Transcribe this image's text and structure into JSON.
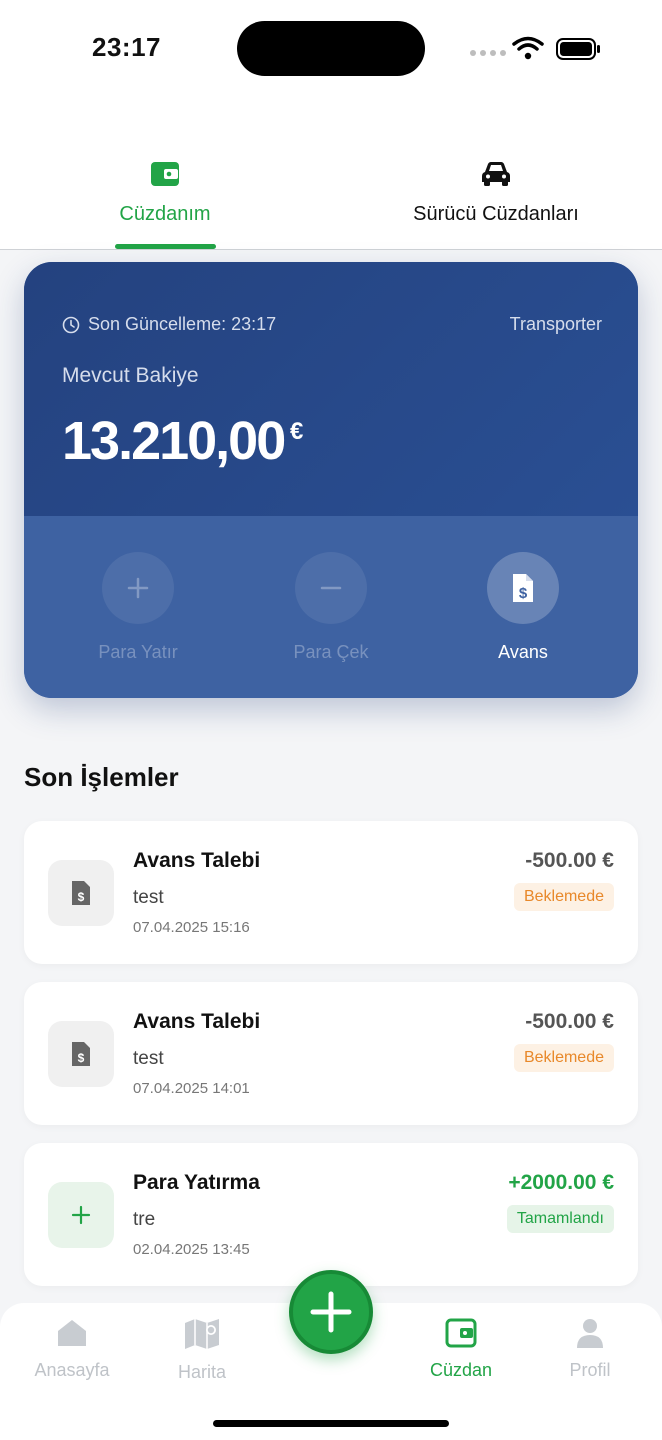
{
  "status_bar": {
    "time": "23:17"
  },
  "tabs": [
    {
      "label": "Cüzdanım",
      "icon": "wallet-icon",
      "active": true
    },
    {
      "label": "Sürücü Cüzdanları",
      "icon": "car-icon",
      "active": false
    }
  ],
  "wallet_card": {
    "updated_label": "Son Güncelleme: 23:17",
    "role": "Transporter",
    "balance_label": "Mevcut Bakiye",
    "balance_amount": "13.210,00",
    "balance_currency": "€",
    "actions": [
      {
        "label": "Para Yatır",
        "icon": "plus-icon",
        "enabled": false
      },
      {
        "label": "Para Çek",
        "icon": "minus-icon",
        "enabled": false
      },
      {
        "label": "Avans",
        "icon": "dollar-document-icon",
        "enabled": true
      }
    ]
  },
  "recent": {
    "title": "Son İşlemler",
    "transactions": [
      {
        "title": "Avans Talebi",
        "description": "test",
        "date": "07.04.2025 15:16",
        "amount": "-500.00 €",
        "status": "Beklemede"
      },
      {
        "title": "Avans Talebi",
        "description": "test",
        "date": "07.04.2025 14:01",
        "amount": "-500.00 €",
        "status": "Beklemede"
      },
      {
        "title": "Para Yatırma",
        "description": "tre",
        "date": "02.04.2025 13:45",
        "amount": "+2000.00 €",
        "status": "Tamamlandı"
      }
    ]
  },
  "bottom_nav": {
    "items": [
      {
        "label": "Anasayfa",
        "icon": "home-icon"
      },
      {
        "label": "Harita",
        "icon": "map-icon"
      },
      {
        "label": "Cüzdan",
        "icon": "wallet-icon",
        "active": true
      },
      {
        "label": "Profil",
        "icon": "profile-icon"
      }
    ]
  },
  "colors": {
    "accent": "#22a447",
    "card": "#24427f",
    "pending": "#e8882a"
  }
}
